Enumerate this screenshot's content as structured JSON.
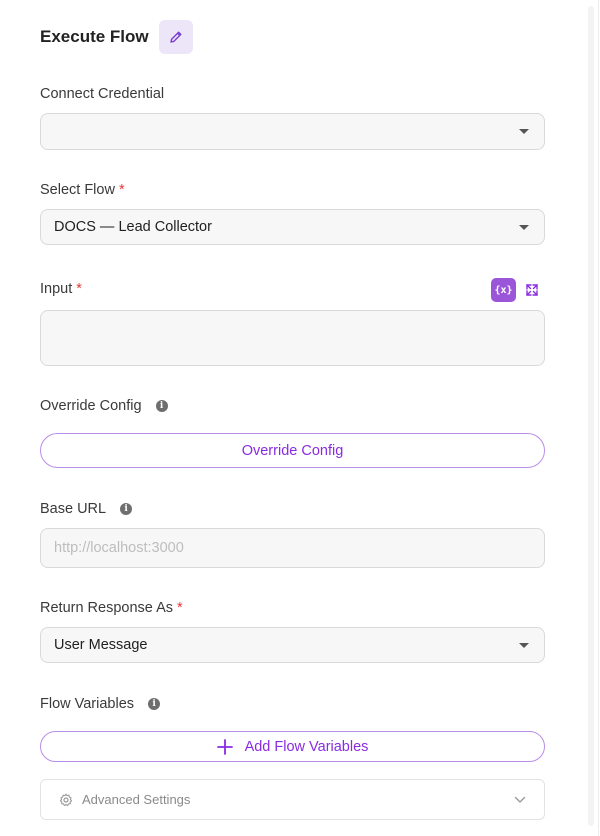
{
  "header": {
    "title": "Execute Flow"
  },
  "fields": {
    "connect_credential": {
      "label": "Connect Credential",
      "value": ""
    },
    "select_flow": {
      "label": "Select Flow",
      "required_mark": "*",
      "value": "DOCS — Lead Collector"
    },
    "input": {
      "label": "Input",
      "required_mark": "*",
      "variable_button": "{x}",
      "value": ""
    },
    "override_config": {
      "label": "Override Config",
      "button_label": "Override Config"
    },
    "base_url": {
      "label": "Base URL",
      "placeholder": "http://localhost:3000"
    },
    "return_response_as": {
      "label": "Return Response As",
      "required_mark": "*",
      "value": "User Message"
    },
    "flow_variables": {
      "label": "Flow Variables",
      "button_label": "Add Flow Variables"
    }
  },
  "advanced": {
    "label": "Advanced Settings"
  },
  "icons": {
    "edit": "pencil-icon",
    "info": "info-icon",
    "dropdown": "chevron-down-icon",
    "expand": "expand-icon",
    "add": "plus-icon",
    "settings": "gear-icon"
  },
  "colors": {
    "accent": "#8a2be2",
    "accent_light": "#ece6f8",
    "required": "#e53935"
  }
}
